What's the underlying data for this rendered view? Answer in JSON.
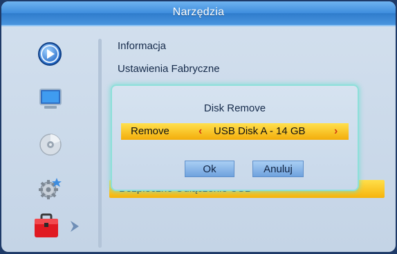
{
  "window": {
    "title": "Narzędzia"
  },
  "sidebar": {
    "icons": [
      {
        "name": "play-icon"
      },
      {
        "name": "tv-icon"
      },
      {
        "name": "disc-icon"
      },
      {
        "name": "settings-gear-icon"
      },
      {
        "name": "toolbox-icon",
        "selected": true
      }
    ]
  },
  "menu": {
    "items": [
      {
        "label": "Informacja"
      },
      {
        "label": "Ustawienia Fabryczne"
      }
    ],
    "highlighted_label": "Bezpieczne Odłączenie USB"
  },
  "dialog": {
    "title": "Disk Remove",
    "option_label": "Remove",
    "option_value": "USB Disk A - 14 GB",
    "ok_label": "Ok",
    "cancel_label": "Anuluj"
  },
  "colors": {
    "title_bar": "#3e8ddd",
    "highlight": "#f6b40c",
    "dialog_border": "#8de0d9",
    "arrow": "#d23a12"
  }
}
